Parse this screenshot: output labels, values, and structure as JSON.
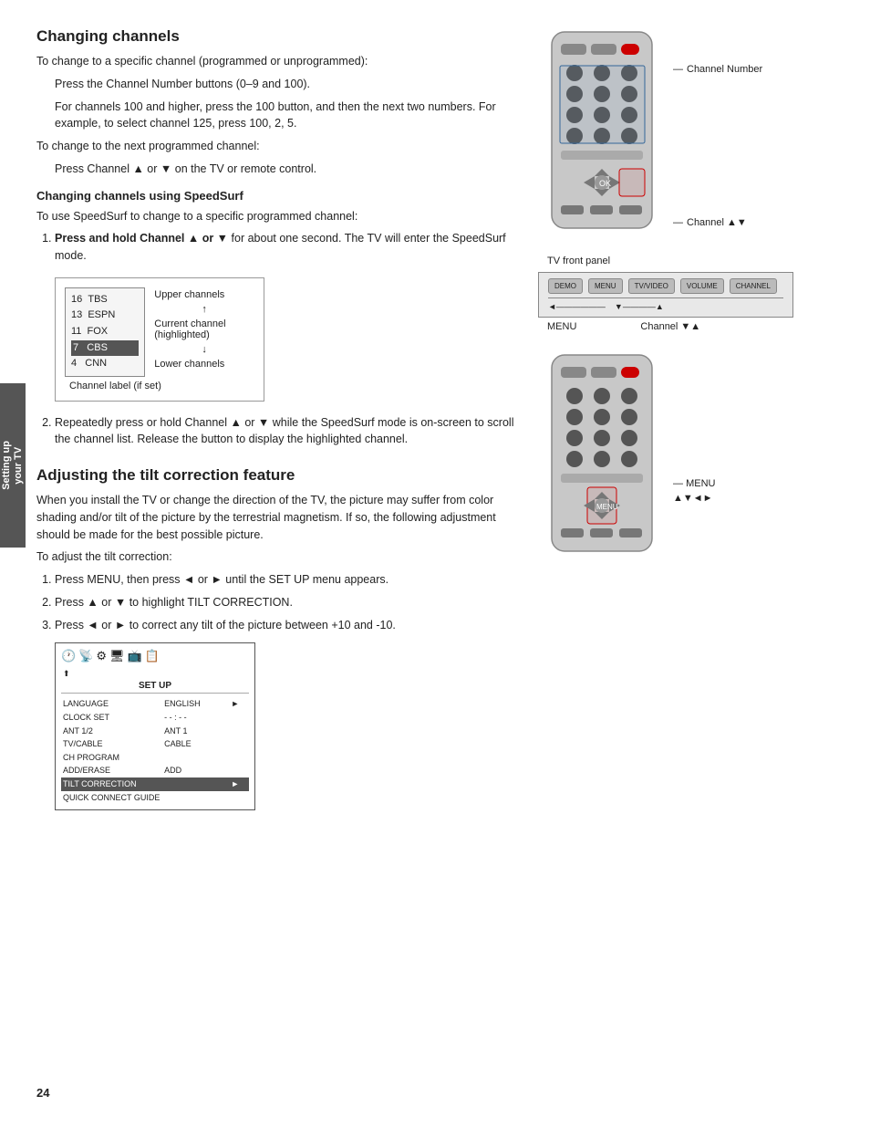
{
  "page": {
    "number": "24",
    "side_tab": "Setting up\nyour TV"
  },
  "sections": {
    "changing_channels": {
      "title": "Changing channels",
      "intro": "To change to a specific channel (programmed or unprogrammed):",
      "step1": "Press the Channel Number buttons (0–9 and 100).",
      "step1b": "For channels 100 and higher, press the 100 button, and then the next two numbers. For example, to select channel 125, press 100, 2, 5.",
      "step2_intro": "To change to the next programmed channel:",
      "step2": "Press Channel ▲ or ▼ on the TV or remote control.",
      "subsection_title": "Changing channels using SpeedSurf",
      "speedsurf_intro": "To use SpeedSurf to change to a specific programmed channel:",
      "speedsurf_step1": "Press and hold Channel ▲ or ▼ for about one second. The TV will enter the SpeedSurf mode.",
      "upper_channels": "Upper channels",
      "current_channel": "Current channel (highlighted)",
      "lower_channels": "Lower channels",
      "channel_label": "Channel label (if set)",
      "speedsurf_step2": "Repeatedly press or hold Channel ▲ or ▼ while the SpeedSurf mode is on-screen to scroll the channel list. Release the button to display the highlighted channel."
    },
    "tilt_correction": {
      "title": "Adjusting the tilt correction feature",
      "intro": "When you install the TV or change the direction of the TV, the picture may suffer from color shading and/or tilt of the picture by the terrestrial magnetism. If so, the following adjustment should be made for the best possible picture.",
      "to_adjust": "To adjust the tilt correction:",
      "step1": "Press MENU, then press ◄ or ► until the SET UP menu appears.",
      "step2": "Press ▲ or ▼ to highlight TILT CORRECTION.",
      "step3": "Press ◄ or ► to correct any tilt of the picture between +10 and -10."
    }
  },
  "annotations": {
    "channel_number": "Channel\nNumber",
    "channel_av": "Channel ▲▼",
    "tv_front_panel": "TV front panel",
    "menu_label": "MENU",
    "channel_va": "Channel ▼▲",
    "menu_label2": "MENU",
    "menu_arrows": "▲▼◄►"
  },
  "channel_list": {
    "items": [
      {
        "num": "16",
        "name": "TBS"
      },
      {
        "num": "13",
        "name": "ESPN"
      },
      {
        "num": "11",
        "name": "FOX"
      },
      {
        "num": "7",
        "name": "CBS",
        "highlighted": true
      },
      {
        "num": "4",
        "name": "CNN"
      }
    ]
  },
  "setup_menu": {
    "title": "SET UP",
    "rows": [
      {
        "label": "LANGUAGE",
        "value": "ENGLISH"
      },
      {
        "label": "CLOCK SET",
        "value": "- - : - -"
      },
      {
        "label": "ANT 1/2",
        "value": "ANT 1"
      },
      {
        "label": "TV/CABLE",
        "value": "CABLE"
      },
      {
        "label": "CH PROGRAM",
        "value": ""
      },
      {
        "label": "ADD/ERASE",
        "value": "ADD"
      },
      {
        "label": "TILT CORRECTION",
        "value": "",
        "highlighted": true
      },
      {
        "label": "QUICK CONNECT GUIDE",
        "value": ""
      }
    ]
  }
}
